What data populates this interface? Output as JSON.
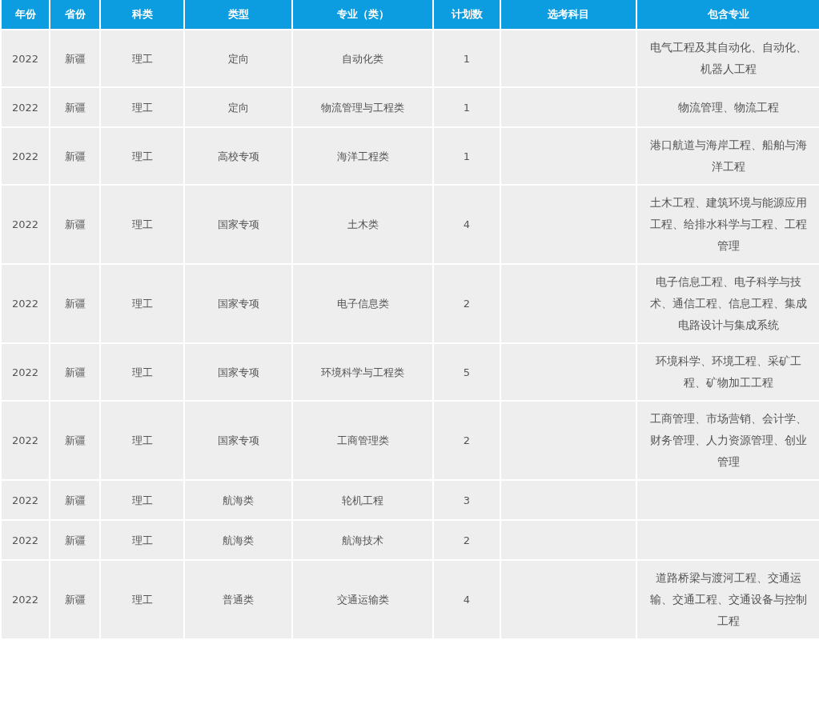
{
  "table": {
    "columns": [
      "年份",
      "省份",
      "科类",
      "类型",
      "专业（类）",
      "计划数",
      "选考科目",
      "包含专业"
    ],
    "rows": [
      {
        "year": "2022",
        "province": "新疆",
        "category": "理工",
        "type": "定向",
        "major": "自动化类",
        "plan": "1",
        "includes": "电气工程及其自动化、自动化、机器人工程"
      },
      {
        "year": "2022",
        "province": "新疆",
        "category": "理工",
        "type": "定向",
        "major": "物流管理与工程类",
        "plan": "1",
        "includes": "物流管理、物流工程"
      },
      {
        "year": "2022",
        "province": "新疆",
        "category": "理工",
        "type": "高校专项",
        "major": "海洋工程类",
        "plan": "1",
        "includes": "港口航道与海岸工程、船舶与海洋工程"
      },
      {
        "year": "2022",
        "province": "新疆",
        "category": "理工",
        "type": "国家专项",
        "major": "土木类",
        "plan": "4",
        "includes": "土木工程、建筑环境与能源应用工程、给排水科学与工程、工程管理"
      },
      {
        "year": "2022",
        "province": "新疆",
        "category": "理工",
        "type": "国家专项",
        "major": "电子信息类",
        "plan": "2",
        "includes": "电子信息工程、电子科学与技术、通信工程、信息工程、集成电路设计与集成系统"
      },
      {
        "year": "2022",
        "province": "新疆",
        "category": "理工",
        "type": "国家专项",
        "major": "环境科学与工程类",
        "plan": "5",
        "includes": "环境科学、环境工程、采矿工程、矿物加工工程"
      },
      {
        "year": "2022",
        "province": "新疆",
        "category": "理工",
        "type": "国家专项",
        "major": "工商管理类",
        "plan": "2",
        "includes": "工商管理、市场营销、会计学、财务管理、人力资源管理、创业管理"
      },
      {
        "year": "2022",
        "province": "新疆",
        "category": "理工",
        "type": "航海类",
        "major": "轮机工程",
        "plan": "3"
      },
      {
        "year": "2022",
        "province": "新疆",
        "category": "理工",
        "type": "航海类",
        "major": "航海技术",
        "plan": "2"
      },
      {
        "year": "2022",
        "province": "新疆",
        "category": "理工",
        "type": "普通类",
        "major": "交通运输类",
        "plan": "4",
        "includes": "道路桥梁与渡河工程、交通运输、交通工程、交通设备与控制工程"
      }
    ]
  }
}
